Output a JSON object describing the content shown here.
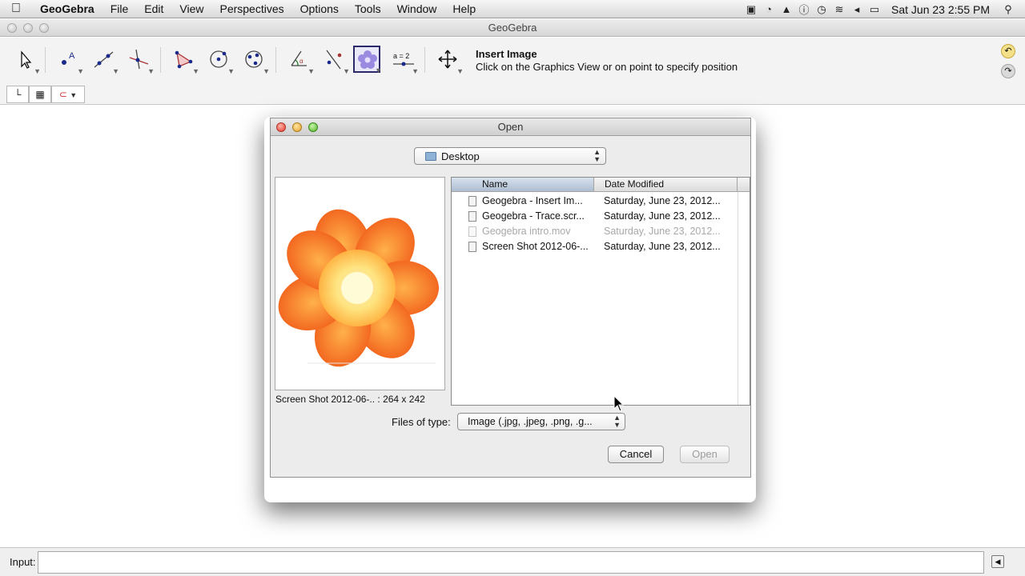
{
  "menubar": {
    "app_name": "GeoGebra",
    "items": [
      "File",
      "Edit",
      "View",
      "Perspectives",
      "Options",
      "Tools",
      "Window",
      "Help"
    ],
    "clock": "Sat Jun 23  2:55 PM"
  },
  "window": {
    "title": "GeoGebra"
  },
  "toolbar": {
    "help_title": "Insert Image",
    "help_text": "Click on the Graphics View or on point to specify position",
    "slider_label": "a = 2"
  },
  "dialog": {
    "title": "Open",
    "folder": "Desktop",
    "columns": {
      "name": "Name",
      "date": "Date Modified"
    },
    "files": [
      {
        "name": "Geogebra - Insert Im...",
        "date": "Saturday, June 23, 2012...",
        "dim": false
      },
      {
        "name": "Geogebra - Trace.scr...",
        "date": "Saturday, June 23, 2012...",
        "dim": false
      },
      {
        "name": "Geogebra intro.mov",
        "date": "Saturday, June 23, 2012...",
        "dim": true
      },
      {
        "name": "Screen Shot 2012-06-...",
        "date": "Saturday, June 23, 2012...",
        "dim": false
      }
    ],
    "preview_caption": "Screen Shot 2012-06-.. : 264 x 242",
    "files_of_type_label": "Files of type:",
    "file_type": "Image (.jpg, .jpeg, .png, .g...",
    "cancel_label": "Cancel",
    "open_label": "Open"
  },
  "input_bar": {
    "label": "Input:"
  }
}
